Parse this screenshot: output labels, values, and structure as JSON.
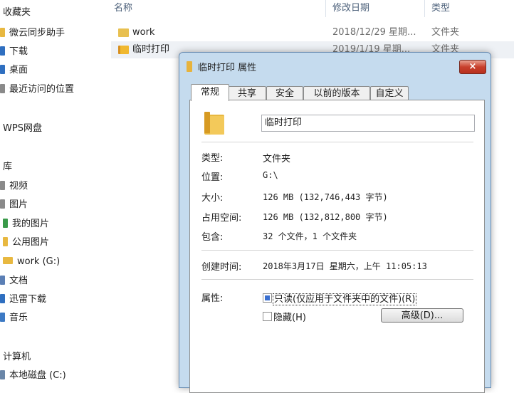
{
  "nav": {
    "favorites_header": "收藏夹",
    "items_fav": [
      "微云同步助手",
      "下载",
      "桌面",
      "最近访问的位置"
    ],
    "wps": "WPS网盘",
    "library_header": "库",
    "items_lib": [
      "视频",
      "图片",
      "我的图片",
      "公用图片",
      "work (G:)",
      "文档",
      "迅雷下载",
      "音乐"
    ],
    "computer_header": "计算机",
    "items_computer": [
      "本地磁盘 (C:)"
    ]
  },
  "filelist": {
    "columns": {
      "name": "名称",
      "date": "修改日期",
      "type": "类型"
    },
    "rows": [
      {
        "name": "work",
        "date": "2018/12/29 星期...",
        "type": "文件夹"
      },
      {
        "name": "临时打印",
        "date": "2019/1/19 星期...",
        "type": "文件夹"
      }
    ]
  },
  "dialog": {
    "title": "临时打印 属性",
    "close_label": "×",
    "tabs": [
      "常规",
      "共享",
      "安全",
      "以前的版本",
      "自定义"
    ],
    "folder_name": "临时打印",
    "props": {
      "type_label": "类型:",
      "type_value": "文件夹",
      "location_label": "位置:",
      "location_value": "G:\\",
      "size_label": "大小:",
      "size_value": "126 MB (132,746,443 字节)",
      "disk_label": "占用空间:",
      "disk_value": "126 MB (132,812,800 字节)",
      "contains_label": "包含:",
      "contains_value": "32 个文件，1 个文件夹",
      "created_label": "创建时间:",
      "created_value": "2018年3月17日 星期六，上午 11:05:13",
      "attr_label": "属性:",
      "readonly_label": "只读(仅应用于文件夹中的文件)(R)",
      "hidden_label": "隐藏(H)",
      "advanced_label": "高级(D)..."
    }
  },
  "colors": {
    "dialog_frame": "#c5dbee",
    "close_button": "#c8402c",
    "folder_icon": "#e8b840"
  }
}
